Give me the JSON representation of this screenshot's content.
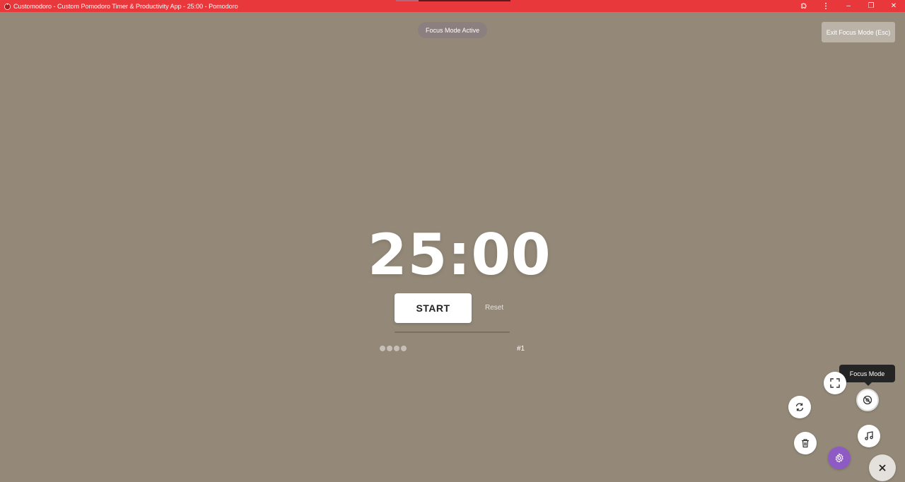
{
  "window": {
    "title": "Customodoro - Custom Pomodoro Timer & Productivity App - 25:00 - Pomodoro",
    "controls": {
      "extensions_icon": "puzzle-icon",
      "menu_icon": "kebab-icon",
      "minimize": "–",
      "restore": "❐",
      "close": "✕"
    }
  },
  "focus": {
    "status_label": "Focus Mode Active",
    "exit_label": "Exit Focus Mode (Esc)"
  },
  "timer": {
    "display": "25:00",
    "start_label": "START",
    "reset_label": "Reset",
    "session_label": "#1",
    "session_dots": 4
  },
  "fabs": {
    "tooltip": "Focus Mode",
    "icons": [
      "fullscreen-icon",
      "focus-mode-icon",
      "sync-icon",
      "music-icon",
      "trash-icon",
      "settings-icon",
      "close-icon"
    ]
  },
  "colors": {
    "titlebar": "#e8383c",
    "background": "#948978",
    "accent": "#8e5bc4"
  }
}
